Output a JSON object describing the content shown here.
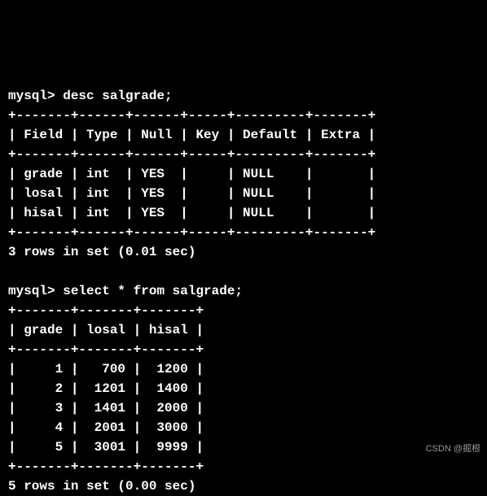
{
  "prompt": "mysql>",
  "commands": {
    "desc": "desc salgrade;",
    "select": "select * from salgrade;"
  },
  "desc_table": {
    "border_top": "+-------+------+------+-----+---------+-------+",
    "header": "| Field | Type | Null | Key | Default | Extra |",
    "border_mid": "+-------+------+------+-----+---------+-------+",
    "rows": [
      "| grade | int  | YES  |     | NULL    |       |",
      "| losal | int  | YES  |     | NULL    |       |",
      "| hisal | int  | YES  |     | NULL    |       |"
    ],
    "border_bot": "+-------+------+------+-----+---------+-------+",
    "summary": "3 rows in set (0.01 sec)"
  },
  "select_table": {
    "border_top": "+-------+-------+-------+",
    "header": "| grade | losal | hisal |",
    "border_mid": "+-------+-------+-------+",
    "rows": [
      "|     1 |   700 |  1200 |",
      "|     2 |  1201 |  1400 |",
      "|     3 |  1401 |  2000 |",
      "|     4 |  2001 |  3000 |",
      "|     5 |  3001 |  9999 |"
    ],
    "border_bot": "+-------+-------+-------+",
    "summary": "5 rows in set (0.00 sec)"
  },
  "watermark": "CSDN @掘根"
}
